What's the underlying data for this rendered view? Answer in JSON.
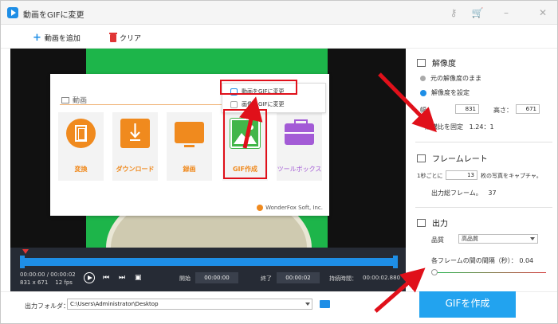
{
  "app": {
    "title": "動画をGIFに変更"
  },
  "toolbar": {
    "add_video": "動画を追加",
    "clear": "クリア"
  },
  "popup": {
    "section_label": "動画",
    "dropdown_items": [
      "動画をGIFに変更",
      "画像をGIFに変更"
    ],
    "tiles": [
      {
        "label": "変換",
        "icon": "film-icon"
      },
      {
        "label": "ダウンロード",
        "icon": "download-icon"
      },
      {
        "label": "録画",
        "icon": "monitor-icon"
      },
      {
        "label": "GIF作成",
        "icon": "gif-image-icon"
      },
      {
        "label": "ツールボックス",
        "icon": "toolbox-icon"
      }
    ],
    "footer": "WonderFox Soft, Inc."
  },
  "timeline": {
    "current_time": "00:00:00",
    "separator": "/",
    "total_time": "00:00:02",
    "resolution": "831 x 671",
    "fps": "12 fps",
    "start_label": "開始",
    "start_value": "00:00:00",
    "end_label": "終了",
    "end_value": "00:00:02",
    "duration_label": "持続時間：",
    "duration_value": "00:00:02.880"
  },
  "output": {
    "label": "出力フォルダ：",
    "path": "C:\\Users\\Administrator\\Desktop",
    "convert_button": "GIFを作成"
  },
  "panel": {
    "resolution": {
      "title": "解像度",
      "option_original": "元の解像度のまま",
      "option_custom": "解像度を設定",
      "width_label": "幅：",
      "width_value": "831",
      "height_label": "高さ：",
      "height_value": "671",
      "aspect_label": "縦横比を固定",
      "aspect_value": "1.24：1"
    },
    "framerate": {
      "title": "フレームレート",
      "per_second_prefix": "1秒ごとに",
      "per_second_value": "13",
      "per_second_suffix": "枚の写真をキャプチャ。",
      "total_label": "出力総フレーム。",
      "total_value": "37"
    },
    "output": {
      "title": "出力",
      "quality_label": "品質",
      "quality_value": "高品質",
      "interval_label": "各フレームの間の間隔（秒）：",
      "interval_value": "0.04"
    }
  }
}
